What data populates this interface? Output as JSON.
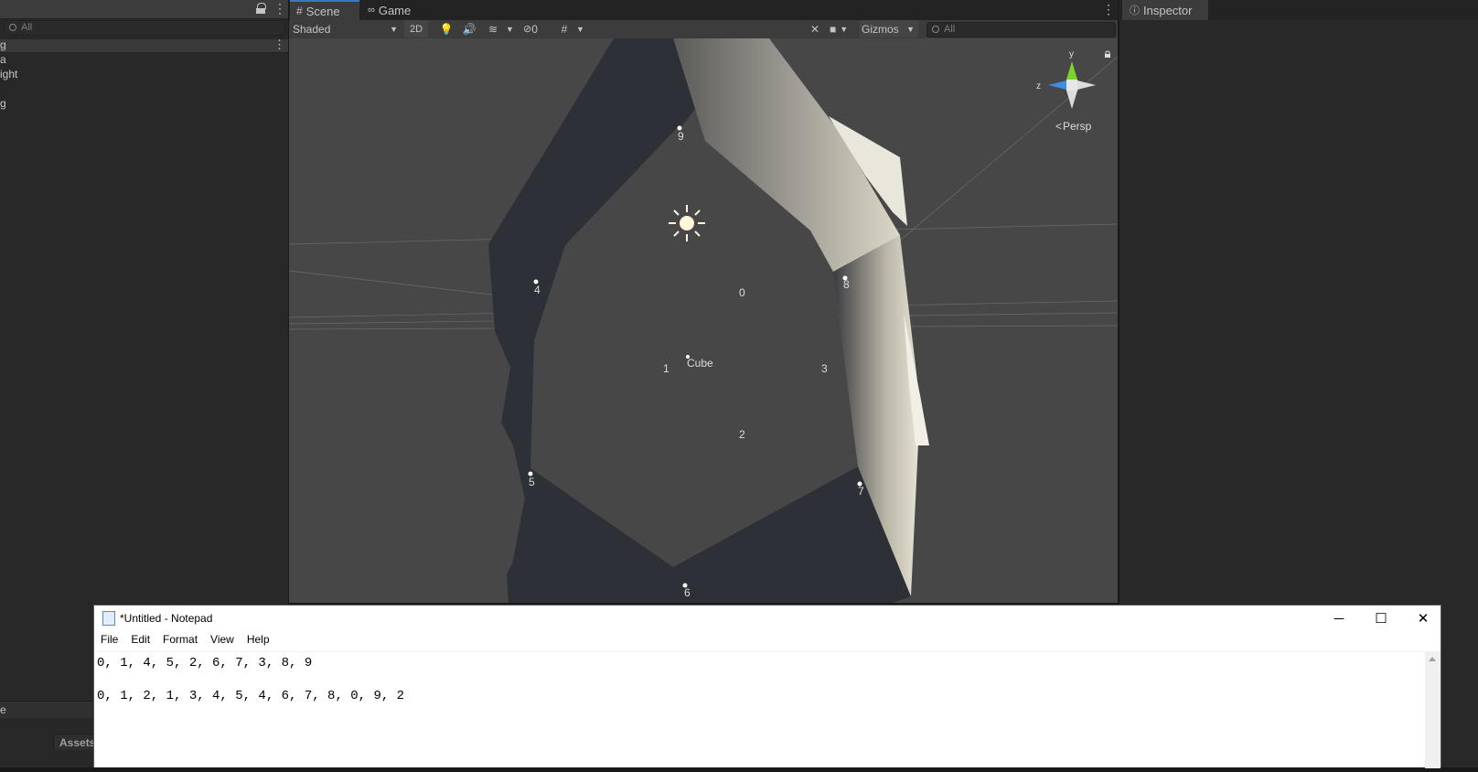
{
  "hierarchy": {
    "search_placeholder": "All",
    "items": [
      "g",
      "a",
      "ight",
      "",
      "g"
    ],
    "bottom_tab": "e",
    "assets_tab": "Assets"
  },
  "scene": {
    "tab_scene": "Scene",
    "tab_game": "Game",
    "shading_mode": "Shaded",
    "mode_2d": "2D",
    "hidden_count": "0",
    "gizmos_label": "Gizmos",
    "search_placeholder": "All",
    "projection_label": "Persp",
    "axis_y": "y",
    "axis_z": "z",
    "object_label": "Cube",
    "vertex_labels": [
      "9",
      "4",
      "0",
      "8",
      "1",
      "3",
      "2",
      "5",
      "7",
      "6"
    ]
  },
  "inspector": {
    "tab_label": "Inspector"
  },
  "notepad": {
    "title": "*Untitled - Notepad",
    "menu": [
      "File",
      "Edit",
      "Format",
      "View",
      "Help"
    ],
    "line1": "0, 1, 4, 5, 2, 6, 7, 3, 8, 9",
    "line2": "",
    "line3": "0, 1, 2, 1, 3, 4, 5, 4, 6, 7, 8, 0, 9, 2"
  },
  "colors": {
    "accent_tab": "#3a79bb",
    "scene_bg": "#474747",
    "mesh_dark": "#2e3038",
    "gizmo_y": "#7dd130",
    "gizmo_z": "#3a8ee6"
  }
}
